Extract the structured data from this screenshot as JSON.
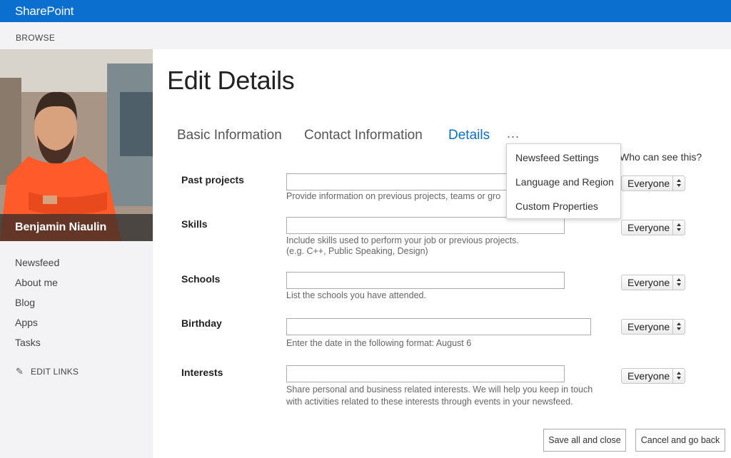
{
  "suite": {
    "brand": "SharePoint"
  },
  "ribbon": {
    "tab": "BROWSE"
  },
  "profile": {
    "name": "Benjamin Niaulin"
  },
  "nav": {
    "links": [
      "Newsfeed",
      "About me",
      "Blog",
      "Apps",
      "Tasks"
    ],
    "edit_links": "EDIT LINKS"
  },
  "page": {
    "title": "Edit Details"
  },
  "tabs": {
    "basic": "Basic Information",
    "contact": "Contact Information",
    "details": "Details",
    "more": "..."
  },
  "visibility_header": "Who can see this?",
  "menu": {
    "items": [
      "Newsfeed Settings",
      "Language and Region",
      "Custom Properties"
    ]
  },
  "fields": {
    "past_projects": {
      "label": "Past projects",
      "hint": "Provide information on previous projects, teams or gro",
      "visibility": "Everyone"
    },
    "skills": {
      "label": "Skills",
      "hint1": "Include skills used to perform your job or previous projects.",
      "hint2": "(e.g. C++, Public Speaking, Design)",
      "visibility": "Everyone"
    },
    "schools": {
      "label": "Schools",
      "hint": "List the schools you have attended.",
      "visibility": "Everyone"
    },
    "birthday": {
      "label": "Birthday",
      "hint": "Enter the date in the following format: August 6",
      "visibility": "Everyone"
    },
    "interests": {
      "label": "Interests",
      "hint1": "Share personal and business related interests. We will help you keep in touch",
      "hint2": "with activities related to these interests through events in your newsfeed.",
      "visibility": "Everyone"
    }
  },
  "buttons": {
    "save": "Save all and close",
    "cancel": "Cancel and go back"
  },
  "colors": {
    "suite_bar": "#0a6fce",
    "active_tab": "#0a6fce",
    "nav_bg": "#f3f2f5"
  },
  "icons": {
    "edit": "pencil-icon",
    "more": "ellipsis-icon",
    "visibility": "up-down-arrows-icon"
  }
}
